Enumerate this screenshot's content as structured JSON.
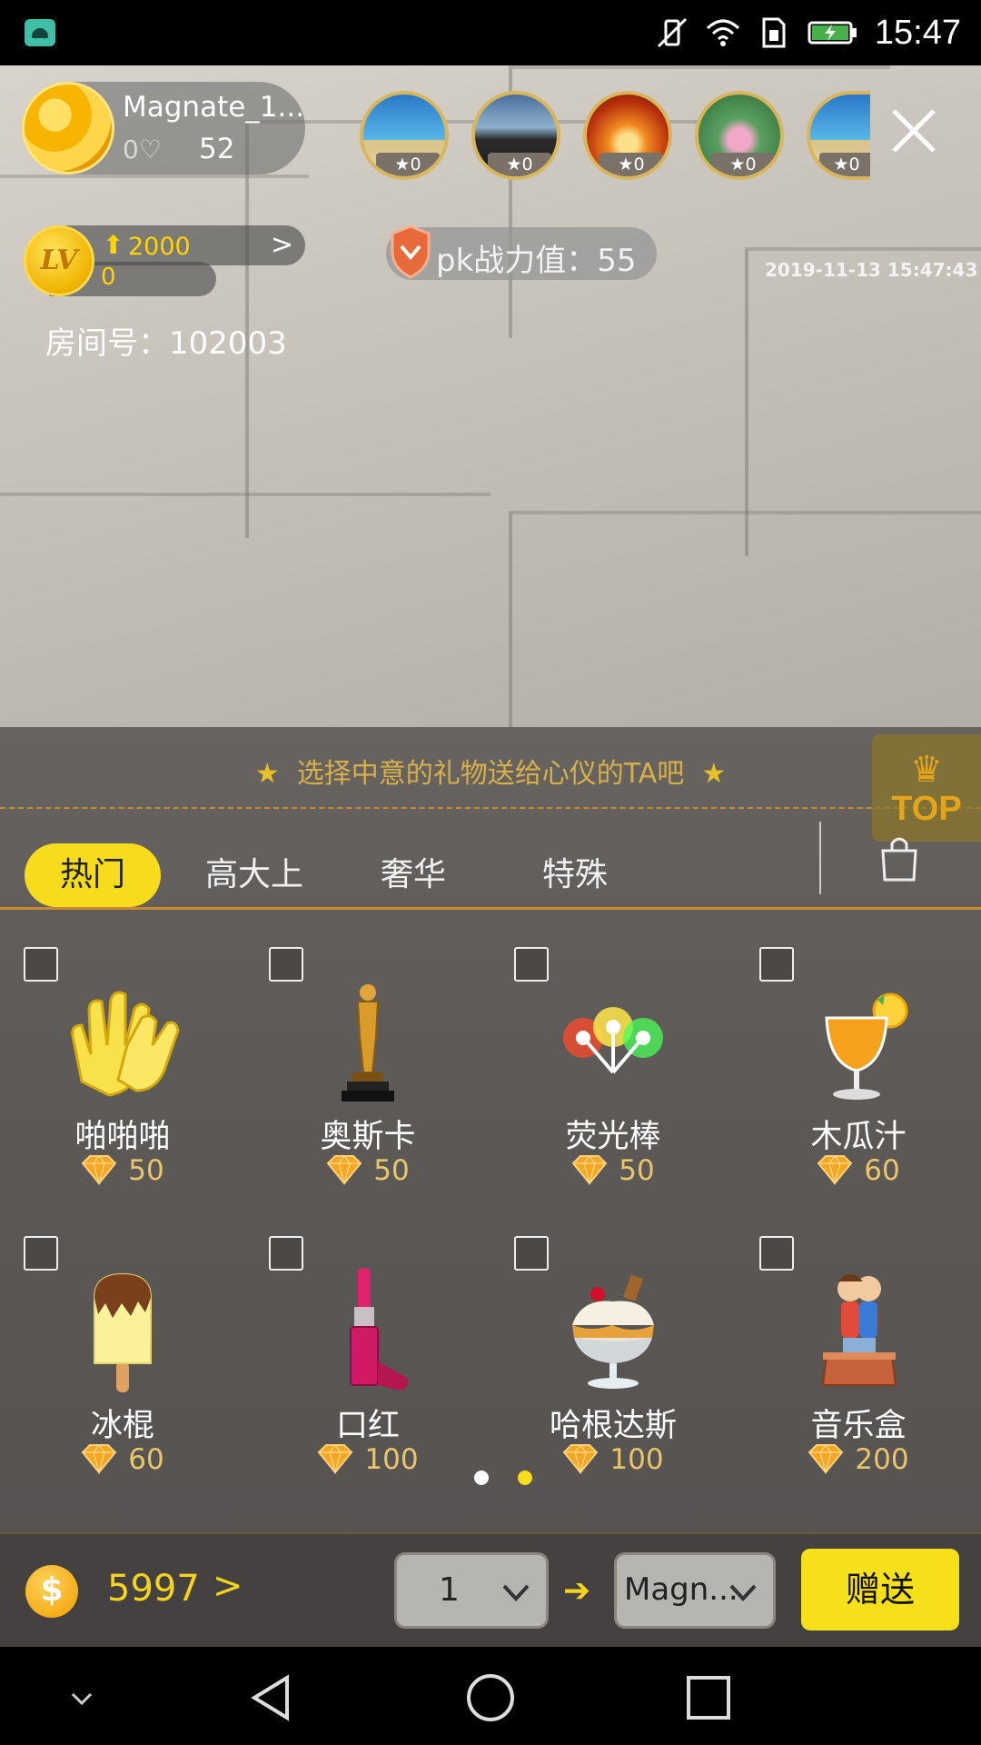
{
  "status_bar": {
    "time": "15:47"
  },
  "host": {
    "name": "Magnate_1...",
    "heart": "0",
    "count": "52"
  },
  "viewers": [
    {
      "badge": "0"
    },
    {
      "badge": "0"
    },
    {
      "badge": "0"
    },
    {
      "badge": "0"
    },
    {
      "badge": "0"
    }
  ],
  "level": {
    "badge": "LV",
    "exp": "2000",
    "value": "0"
  },
  "pk": {
    "text": "pk战力值：55"
  },
  "timestamp": "2019-11-13 15:47:43",
  "room": {
    "text": "房间号：102003"
  },
  "panel": {
    "hint": "选择中意的礼物送给心仪的TA吧",
    "top_label": "TOP",
    "tabs": [
      "热门",
      "高大上",
      "奢华",
      "特殊"
    ],
    "gifts": [
      {
        "name": "啪啪啪",
        "price": "50",
        "icon": "clapping-hands-icon"
      },
      {
        "name": "奥斯卡",
        "price": "50",
        "icon": "oscar-statue-icon"
      },
      {
        "name": "荧光棒",
        "price": "50",
        "icon": "glow-stick-icon"
      },
      {
        "name": "木瓜汁",
        "price": "60",
        "icon": "papaya-juice-icon"
      },
      {
        "name": "冰棍",
        "price": "60",
        "icon": "popsicle-icon"
      },
      {
        "name": "口红",
        "price": "100",
        "icon": "lipstick-icon"
      },
      {
        "name": "哈根达斯",
        "price": "100",
        "icon": "ice-cream-sundae-icon"
      },
      {
        "name": "音乐盒",
        "price": "200",
        "icon": "music-box-icon"
      }
    ],
    "page_current": 2,
    "page_count": 2
  },
  "bottom": {
    "balance": "5997",
    "quantity": "1",
    "recipient": "Magn...",
    "send_label": "赠送"
  },
  "colors": {
    "accent": "#f6dc1c",
    "gold": "#e9c66a",
    "border": "#c98a2f"
  }
}
